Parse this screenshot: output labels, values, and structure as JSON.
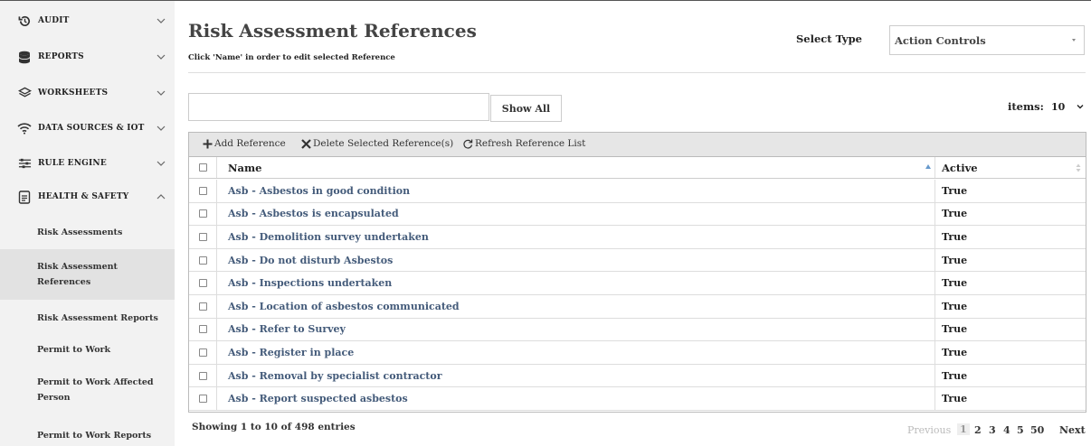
{
  "sidebar": {
    "items": [
      {
        "label": "AUDIT",
        "icon": "audit-icon",
        "expanded": false
      },
      {
        "label": "REPORTS",
        "icon": "database-icon",
        "expanded": false
      },
      {
        "label": "WORKSHEETS",
        "icon": "layers-icon",
        "expanded": false
      },
      {
        "label": "DATA SOURCES & IOT",
        "icon": "wifi-icon",
        "expanded": false
      },
      {
        "label": "RULE ENGINE",
        "icon": "sliders-icon",
        "expanded": false
      },
      {
        "label": "HEALTH & SAFETY",
        "icon": "document-icon",
        "expanded": true
      }
    ],
    "subitems": [
      {
        "label": "Risk Assessments"
      },
      {
        "label": "Risk Assessment References",
        "active": true
      },
      {
        "label": "Risk Assessment Reports"
      },
      {
        "label": "Permit to Work"
      },
      {
        "label": "Permit to Work Affected Person"
      },
      {
        "label": "Permit to Work Reports"
      }
    ]
  },
  "main": {
    "title": "Risk Assessment References",
    "subtitle": "Click 'Name' in order to edit selected Reference",
    "select_type_label": "Select Type",
    "select_type_value": "Action Controls",
    "search_value": "",
    "show_all_label": "Show All",
    "items_label": "items:",
    "items_value": "10"
  },
  "toolbar": {
    "add_label": "Add Reference",
    "delete_label": "Delete Selected Reference(s)",
    "refresh_label": "Refresh Reference List"
  },
  "table": {
    "columns": [
      "Name",
      "Active"
    ],
    "rows": [
      {
        "name": "Asb - Asbestos in good condition",
        "active": "True"
      },
      {
        "name": "Asb - Asbestos is encapsulated",
        "active": "True"
      },
      {
        "name": "Asb - Demolition survey undertaken",
        "active": "True"
      },
      {
        "name": "Asb - Do not disturb Asbestos",
        "active": "True"
      },
      {
        "name": "Asb - Inspections undertaken",
        "active": "True"
      },
      {
        "name": "Asb - Location of asbestos communicated",
        "active": "True"
      },
      {
        "name": "Asb - Refer to Survey",
        "active": "True"
      },
      {
        "name": "Asb - Register in place",
        "active": "True"
      },
      {
        "name": "Asb - Removal by specialist contractor",
        "active": "True"
      },
      {
        "name": "Asb - Report suspected asbestos",
        "active": "True"
      }
    ]
  },
  "footer": {
    "info": "Showing 1 to 10 of 498 entries",
    "pagination": {
      "previous": "Previous",
      "pages": [
        "1",
        "2",
        "3",
        "4",
        "5",
        "50"
      ],
      "next": "Next",
      "current": "1"
    }
  },
  "colors": {
    "link": "#445b7a",
    "sidebar_bg": "#f2f2f2",
    "sidebar_active": "#e2e2e2",
    "toolbar_bg": "#e6e6e6",
    "sort_indicator": "#6699cc"
  }
}
